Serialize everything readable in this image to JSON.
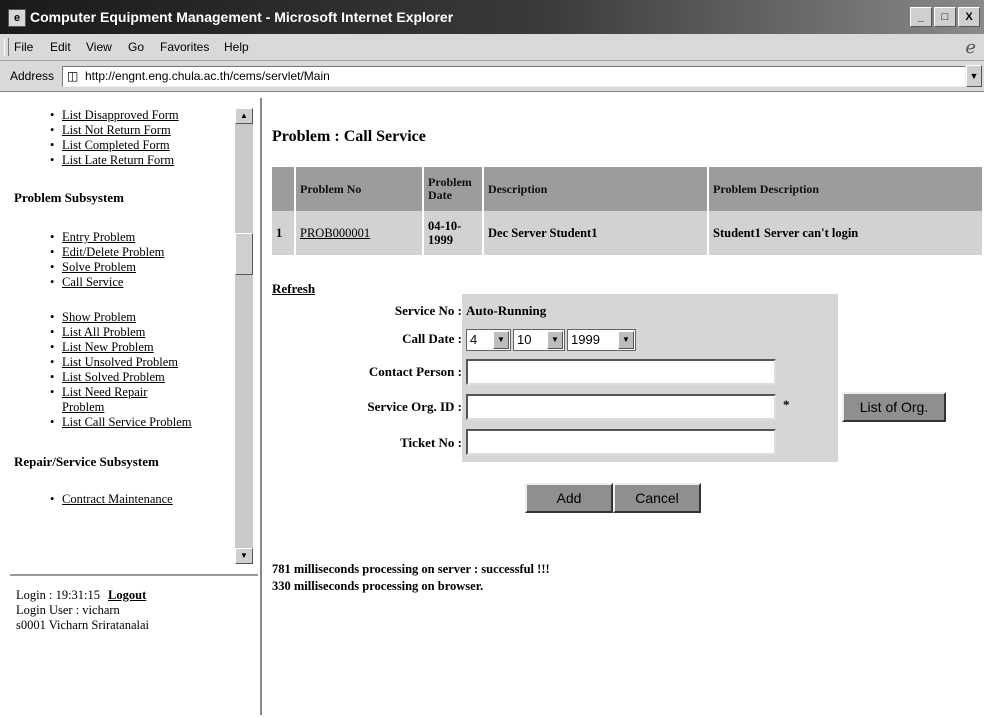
{
  "window": {
    "title": "Computer Equipment Management - Microsoft Internet Explorer",
    "app_icon": "ie-window-icon",
    "buttons": [
      "_",
      "□",
      "X"
    ]
  },
  "menubar": {
    "items": [
      "File",
      "Edit",
      "View",
      "Go",
      "Favorites",
      "Help"
    ]
  },
  "addressbar": {
    "label": "Address",
    "url": "http://engnt.eng.chula.ac.th/cems/servlet/Main"
  },
  "nav": {
    "top_links": [
      "List Disapproved Form",
      "List Not Return Form",
      "List Completed Form",
      "List Late Return Form"
    ],
    "problem_heading": "Problem Subsystem",
    "problem_links_1": [
      "Entry Problem",
      "Edit/Delete Problem",
      "Solve Problem",
      "Call Service"
    ],
    "problem_links_2": [
      "Show Problem",
      "List All Problem",
      "List New Problem",
      "List Unsolved Problem",
      "List Solved Problem",
      "List Need Repair Problem",
      "List Call Service Problem"
    ],
    "repair_heading": "Repair/Service Subsystem",
    "cut_link": "Contract Maintenance"
  },
  "login": {
    "time_label": "Login : 19:31:15",
    "logout": "Logout",
    "user_label": "Login User : vicharn",
    "user_id_name": "s0001   Vicharn Sriratanalai"
  },
  "page": {
    "title": "Problem : Call Service",
    "table": {
      "headers": [
        "",
        "Problem No",
        "Problem Date",
        "Description",
        "Problem Description"
      ],
      "rows": [
        {
          "idx": "1",
          "problem_no": "PROB000001",
          "date": "04-10-1999",
          "description": "Dec Server Student1",
          "problem_description": "Student1 Server can't login"
        }
      ]
    },
    "refresh": "Refresh",
    "form": {
      "service_no_label": "Service No :",
      "service_no_value": "Auto-Running",
      "call_date_label": "Call Date :",
      "day": "4",
      "month": "10",
      "year": "1999",
      "contact_label": "Contact Person :",
      "contact_value": "",
      "org_label": "Service Org. ID :",
      "org_value": "",
      "required_mark": "*",
      "list_org_button": "List of Org.",
      "ticket_label": "Ticket No :",
      "ticket_value": "",
      "add_button": "Add",
      "cancel_button": "Cancel"
    },
    "status_lines": [
      "781 milliseconds processing on server : successful !!!",
      "330 milliseconds processing on browser."
    ]
  }
}
